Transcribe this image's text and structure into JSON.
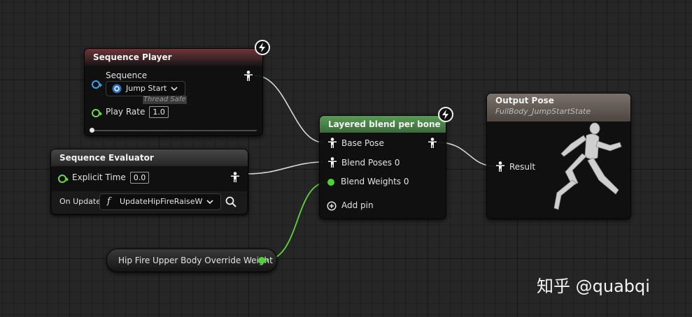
{
  "sequence_player": {
    "title": "Sequence Player",
    "sequence_label": "Sequence",
    "sequence_value": "Jump Start",
    "thread_safe": "Thread Safe",
    "play_rate_label": "Play Rate",
    "play_rate_value": "1.0"
  },
  "sequence_evaluator": {
    "title": "Sequence Evaluator",
    "explicit_time_label": "Explicit Time",
    "explicit_time_value": "0.0",
    "on_update_label": "On Update",
    "on_update_function": "UpdateHipFireRaiseWea",
    "function_glyph": "f"
  },
  "layered_blend": {
    "title": "Layered blend per bone",
    "base_pose": "Base Pose",
    "blend_poses": "Blend Poses 0",
    "blend_weights": "Blend Weights 0",
    "add_pin": "Add pin"
  },
  "output_pose": {
    "title": "Output Pose",
    "subtitle": "FullBody_JumpStartState",
    "result": "Result"
  },
  "variable_node": {
    "label": "Hip Fire Upper Body Override Weight"
  },
  "watermark": "知乎 @quabqi",
  "colors": {
    "pose_wire": "#d8d8d8",
    "float_wire": "#5fd33c",
    "anim_pin": "#3aa3e6",
    "float_pin": "#6ed74f"
  },
  "icons": [
    "fast-path-bolt-icon",
    "pose-pin-icon",
    "dropdown-chevron-icon",
    "search-icon",
    "add-pin-icon",
    "mannequin-preview-icon",
    "function-icon",
    "anim-sequence-icon"
  ]
}
